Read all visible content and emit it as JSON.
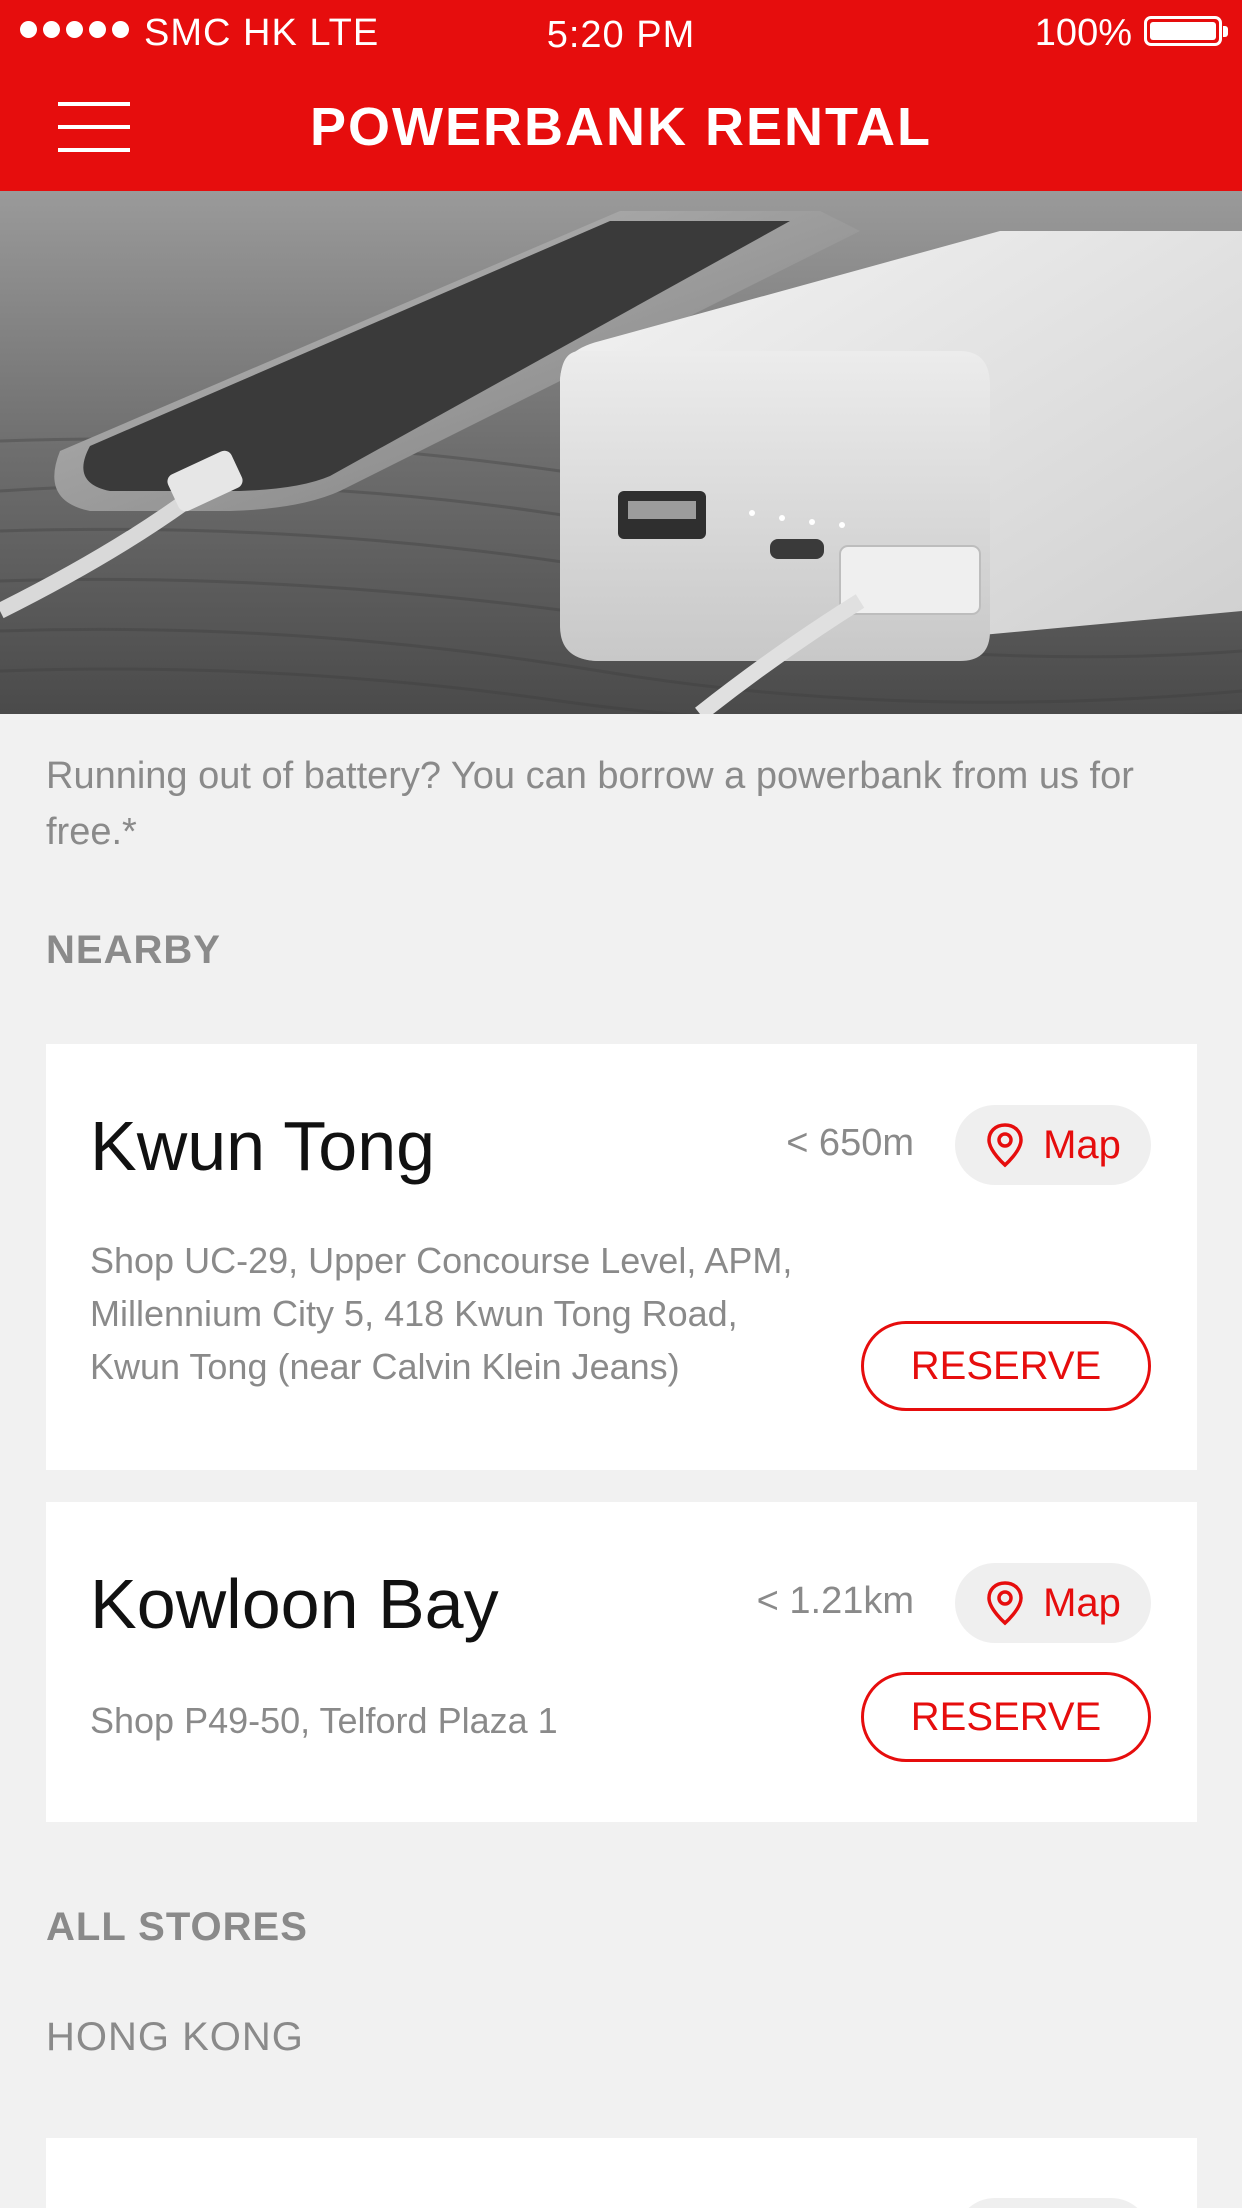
{
  "status_bar": {
    "carrier": "SMC HK LTE",
    "time": "5:20 PM",
    "battery": "100%"
  },
  "header": {
    "title": "POWERBANK RENTAL",
    "menu_icon": "hamburger-menu-icon"
  },
  "hero": {
    "image": "powerbank-charging-phone-photo"
  },
  "intro": {
    "text": "Running out of battery? You can borrow a powerbank from us for free.*"
  },
  "nearby": {
    "label": "NEARBY",
    "stores": [
      {
        "name": "Kwun Tong",
        "distance": "< 650m",
        "map_label": "Map",
        "address_lines": [
          "Shop UC-29, Upper Concourse Level, APM,",
          "Millennium City 5, 418 Kwun Tong Road,",
          "Kwun Tong (near Calvin Klein Jeans)"
        ],
        "reserve_label": "RESERVE"
      },
      {
        "name": "Kowloon Bay",
        "distance": "< 1.21km",
        "map_label": "Map",
        "address_lines": [
          "Shop P49-50, Telford Plaza 1"
        ],
        "reserve_label": "RESERVE"
      }
    ]
  },
  "all_stores": {
    "label": "ALL STORES",
    "region": "HONG KONG"
  },
  "colors": {
    "accent": "#e60d0d",
    "background": "#f1f1f1",
    "card": "#ffffff",
    "muted_text": "#8a8a8a"
  }
}
